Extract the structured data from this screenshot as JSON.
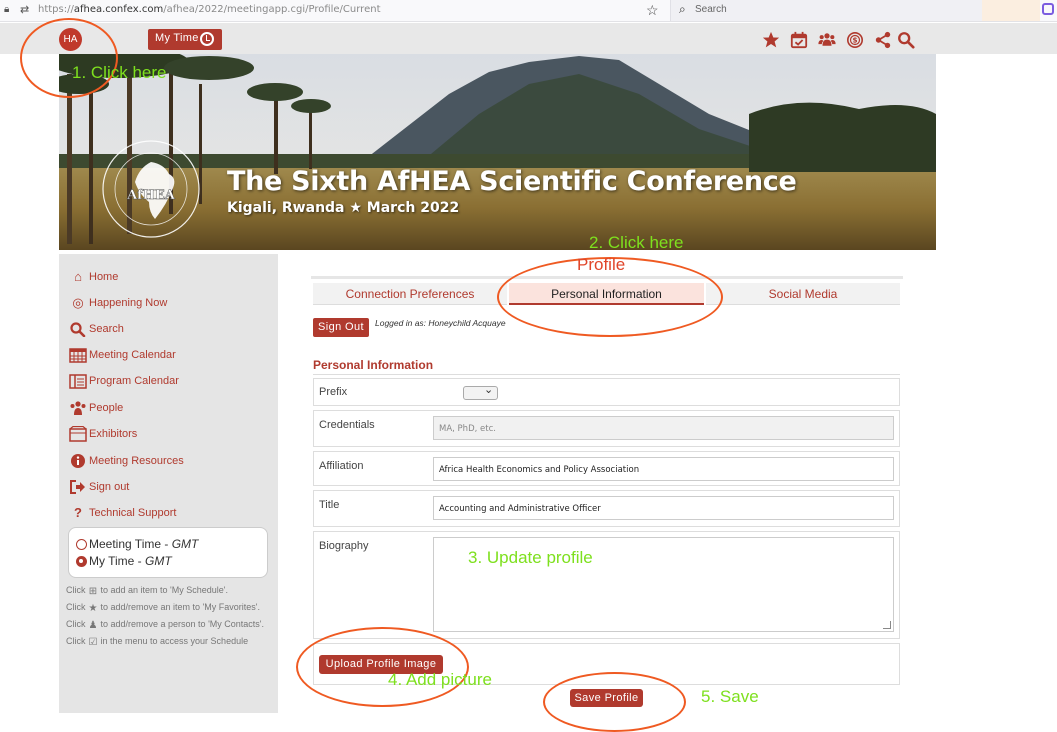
{
  "browser": {
    "url_prefix": "https://",
    "url_domain": "afhea.confex.com",
    "url_path": "/afhea/2022/meetingapp.cgi/Profile/Current",
    "search_placeholder": "Search"
  },
  "topbar": {
    "avatar_initials": "HA",
    "mytime_label": "My Time",
    "icons": [
      "star-icon",
      "calendar-check-icon",
      "people-icon",
      "happening-now-icon",
      "share-icon",
      "search-icon"
    ]
  },
  "banner": {
    "title": "The Sixth AfHEA Scientific Conference",
    "subtitle": "Kigali, Rwanda ★ March 2022",
    "logo_text": "AfHEA"
  },
  "sidebar": {
    "items": [
      {
        "label": "Home",
        "icon": "home-icon"
      },
      {
        "label": "Happening Now",
        "icon": "happening-now-icon"
      },
      {
        "label": "Search",
        "icon": "search-icon"
      },
      {
        "label": "Meeting Calendar",
        "icon": "calendar-icon"
      },
      {
        "label": "Program Calendar",
        "icon": "program-calendar-icon"
      },
      {
        "label": "People",
        "icon": "people-icon"
      },
      {
        "label": "Exhibitors",
        "icon": "exhibitors-icon"
      },
      {
        "label": "Meeting Resources",
        "icon": "info-icon"
      },
      {
        "label": "Sign out",
        "icon": "sign-out-icon"
      },
      {
        "label": "Technical Support",
        "icon": "question-icon"
      }
    ],
    "timezone": {
      "meeting_label": "Meeting Time - ",
      "meeting_zone": "GMT",
      "my_label": "My Time - ",
      "my_zone": "GMT",
      "selected": "my"
    },
    "help": [
      {
        "pre": "Click",
        "post": "to add an item to 'My Schedule'."
      },
      {
        "pre": "Click",
        "post": "to add/remove an item to 'My Favorites'."
      },
      {
        "pre": "Click",
        "post": "to add/remove a person to 'My Contacts'."
      },
      {
        "pre": "Click",
        "post": "in the menu to access your Schedule"
      }
    ]
  },
  "tabs": [
    {
      "label": "Connection Preferences",
      "active": false
    },
    {
      "label": "Personal Information",
      "active": true
    },
    {
      "label": "Social Media",
      "active": false
    }
  ],
  "account": {
    "sign_out": "Sign Out",
    "logged_in_as": "Logged in as: Honeychild Acquaye"
  },
  "form": {
    "section_title": "Personal Information",
    "prefix_label": "Prefix",
    "credentials_label": "Credentials",
    "credentials_placeholder": "MA, PhD, etc.",
    "affiliation_label": "Affiliation",
    "affiliation_value": "Africa Health Economics and Policy Association",
    "title_label": "Title",
    "title_value": "Accounting and Administrative Officer",
    "biography_label": "Biography",
    "upload_button": "Upload Profile Image",
    "save_button": "Save Profile"
  },
  "annotations": {
    "step1": "1. Click here",
    "step2": "2. Click here",
    "step2_sub": "Profile",
    "step3": "3. Update profile",
    "step4": "4. Add picture",
    "step5": "5. Save",
    "oval_color": "#ef5a22",
    "text_color": "#7ee01e"
  }
}
